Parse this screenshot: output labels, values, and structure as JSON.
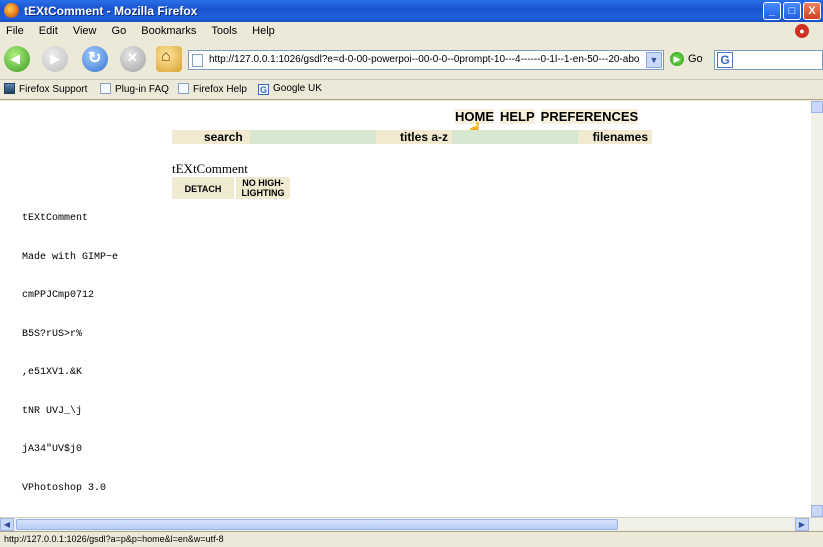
{
  "window": {
    "title": "tEXtComment - Mozilla Firefox",
    "controls": {
      "minimize": "_",
      "maximize": "□",
      "close": "X"
    }
  },
  "menubar": {
    "items": [
      "File",
      "Edit",
      "View",
      "Go",
      "Bookmarks",
      "Tools",
      "Help"
    ]
  },
  "navbar": {
    "url": "http://127.0.0.1:1026/gsdl?e=d-0-00-powerpoi--00-0-0--0prompt-10---4------0-1l--1-en-50---20-abou",
    "go_label": "Go",
    "search_engine_icon": "G"
  },
  "bookmarks": {
    "items": [
      "Firefox Support",
      "Plug-in FAQ",
      "Firefox Help",
      "Google UK"
    ]
  },
  "page": {
    "top_links": [
      "HOME",
      "HELP",
      "PREFERENCES"
    ],
    "nav": {
      "search": "search",
      "titles": "titles a-z",
      "filenames": "filenames"
    },
    "collection_title": "tEXtComment",
    "buttons": {
      "detach": "DETACH",
      "no_highlighting": "NO HIGH-\nLIGHTING"
    },
    "document_lines": [
      "tEXtComment",
      "Made with GIMP~e",
      "cmPPJCmp0712",
      "B5S?rUS>r%",
      ",e51XV1.&K",
      "tNR UVJ_\\j",
      "jA34\"UV$j0",
      "VPhotoshop 3.0"
    ]
  },
  "status": {
    "text": "http://127.0.0.1:1026/gsdl?a=p&p=home&l=en&w=utf-8"
  }
}
